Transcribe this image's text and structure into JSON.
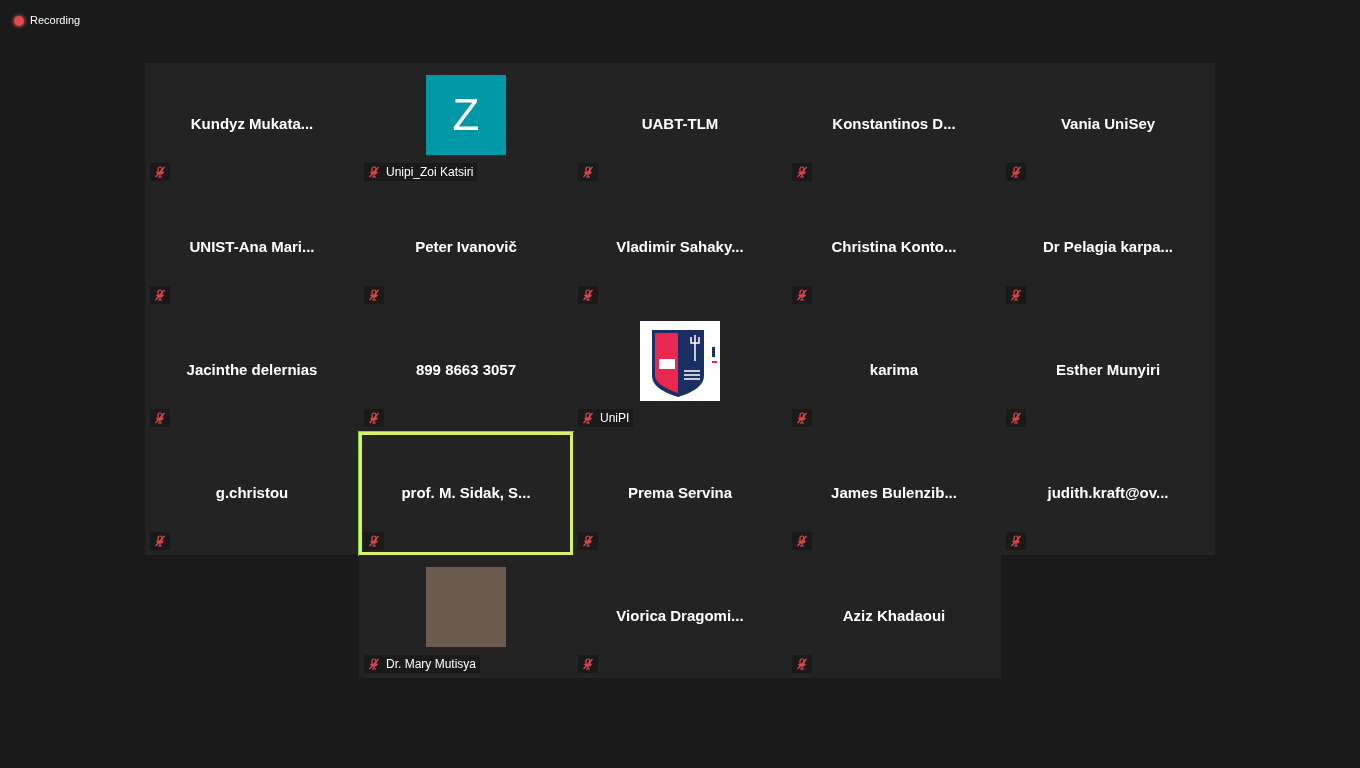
{
  "recording": {
    "label": "Recording",
    "on": true
  },
  "participants": [
    {
      "kind": "name",
      "name": "Kundyz  Mukata...",
      "muted": true,
      "speaking": false
    },
    {
      "kind": "avatar",
      "initial": "Z",
      "color": "#0097a7",
      "name": "Unipi_Zoi Katsiri",
      "muted": true,
      "speaking": false
    },
    {
      "kind": "name",
      "name": "UABT-TLM",
      "muted": true,
      "speaking": false
    },
    {
      "kind": "name",
      "name": "Konstantinos  D...",
      "muted": true,
      "speaking": false
    },
    {
      "kind": "name",
      "name": "Vania UniSey",
      "muted": true,
      "speaking": false
    },
    {
      "kind": "name",
      "name": "UNIST-Ana  Mari...",
      "muted": true,
      "speaking": false
    },
    {
      "kind": "name",
      "name": "Peter Ivanovič",
      "muted": true,
      "speaking": false
    },
    {
      "kind": "name",
      "name": "Vladimir  Sahaky...",
      "muted": true,
      "speaking": false
    },
    {
      "kind": "name",
      "name": "Christina  Konto...",
      "muted": true,
      "speaking": false
    },
    {
      "kind": "name",
      "name": "Dr  Pelagia  karpa...",
      "muted": true,
      "speaking": false
    },
    {
      "kind": "name",
      "name": "Jacinthe delernias",
      "muted": true,
      "speaking": false
    },
    {
      "kind": "name",
      "name": "899 8663 3057",
      "muted": true,
      "speaking": false
    },
    {
      "kind": "logo",
      "name": "UniPI",
      "muted": true,
      "speaking": false
    },
    {
      "kind": "name",
      "name": "karima",
      "muted": true,
      "speaking": false
    },
    {
      "kind": "name",
      "name": "Esther Munyiri",
      "muted": true,
      "speaking": false
    },
    {
      "kind": "name",
      "name": "g.christou",
      "muted": true,
      "speaking": false
    },
    {
      "kind": "name",
      "name": "prof.  M.  Sidak,  S...",
      "muted": true,
      "speaking": true
    },
    {
      "kind": "name",
      "name": "Prema Servina",
      "muted": true,
      "speaking": false
    },
    {
      "kind": "name",
      "name": "James  Bulenzib...",
      "muted": true,
      "speaking": false
    },
    {
      "kind": "name",
      "name": "judith.kraft@ov...",
      "muted": true,
      "speaking": false
    },
    {
      "kind": "photo",
      "name": "Dr. Mary Mutisya",
      "muted": true,
      "speaking": false
    },
    {
      "kind": "name",
      "name": "Viorica  Dragomi...",
      "muted": true,
      "speaking": false
    },
    {
      "kind": "name",
      "name": "Aziz Khadaoui",
      "muted": true,
      "speaking": false
    }
  ]
}
